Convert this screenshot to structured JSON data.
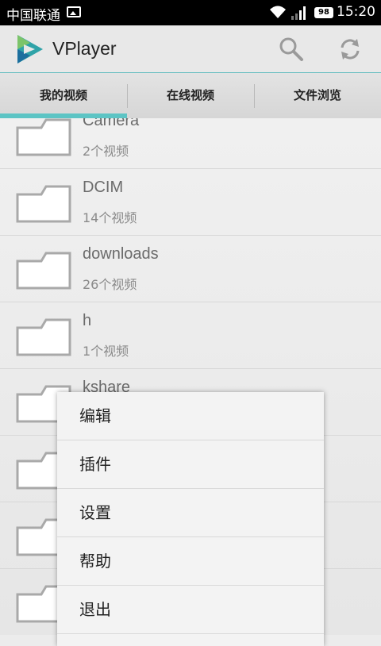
{
  "status_bar": {
    "carrier": "中国联通",
    "battery": "98",
    "time": "15:20",
    "icons": [
      "image-notification-icon",
      "wifi-icon",
      "signal-icon",
      "battery-icon"
    ]
  },
  "action_bar": {
    "title": "VPlayer",
    "icons": [
      "vplayer-logo-icon",
      "search-icon",
      "refresh-icon"
    ]
  },
  "tabs": [
    {
      "label": "我的视频",
      "selected": true
    },
    {
      "label": "在线视频",
      "selected": false
    },
    {
      "label": "文件浏览",
      "selected": false
    }
  ],
  "folders": [
    {
      "name": "Camera",
      "count": "2个视频"
    },
    {
      "name": "DCIM",
      "count": "14个视频"
    },
    {
      "name": "downloads",
      "count": "26个视频"
    },
    {
      "name": "h",
      "count": "1个视频"
    },
    {
      "name": "kshare",
      "count": ""
    },
    {
      "name": "",
      "count": ""
    },
    {
      "name": "",
      "count": ""
    },
    {
      "name": "",
      "count": ""
    }
  ],
  "menu": {
    "items": [
      "编辑",
      "插件",
      "设置",
      "帮助",
      "退出"
    ]
  },
  "colors": {
    "accent": "#5cc4c4",
    "status_bar": "#000000",
    "action_bar": "#e8e8e8"
  }
}
